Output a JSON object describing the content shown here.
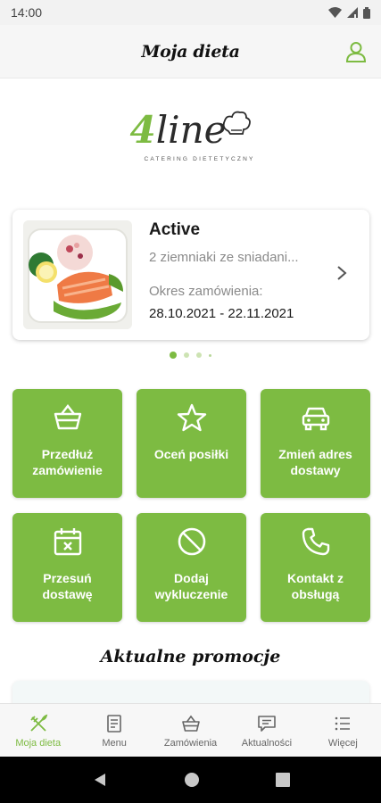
{
  "status_bar": {
    "time": "14:00"
  },
  "header": {
    "title": "Moja dieta"
  },
  "logo": {
    "number": "4",
    "word": "line",
    "tagline": "CATERING DIETETYCZNY"
  },
  "order_card": {
    "status": "Active",
    "menu": "2 ziemniaki ze sniadani...",
    "period_label": "Okres zamówienia:",
    "period_value": "28.10.2021 - 22.11.2021"
  },
  "carousel": {
    "page_count": 4,
    "active_index": 0
  },
  "actions": [
    {
      "label": "Przedłuż\nzamówienie",
      "icon": "basket-icon"
    },
    {
      "label": "Oceń posiłki",
      "icon": "star-icon"
    },
    {
      "label": "Zmień adres\ndostawy",
      "icon": "car-icon"
    },
    {
      "label": "Przesuń\ndostawę",
      "icon": "calendar-x-icon"
    },
    {
      "label": "Dodaj\nwykluczenie",
      "icon": "block-icon"
    },
    {
      "label": "Kontakt z\nobsługą",
      "icon": "phone-icon"
    }
  ],
  "promotions": {
    "title": "Aktualne promocje"
  },
  "bottom_nav": [
    {
      "label": "Moja dieta",
      "icon": "cutlery-icon",
      "active": true
    },
    {
      "label": "Menu",
      "icon": "document-icon",
      "active": false
    },
    {
      "label": "Zamówienia",
      "icon": "basket-icon",
      "active": false
    },
    {
      "label": "Aktualności",
      "icon": "chat-icon",
      "active": false
    },
    {
      "label": "Więcej",
      "icon": "list-icon",
      "active": false
    }
  ],
  "colors": {
    "accent": "#7dbb42",
    "text": "#1a1a1a",
    "muted": "#8a8a8a"
  }
}
